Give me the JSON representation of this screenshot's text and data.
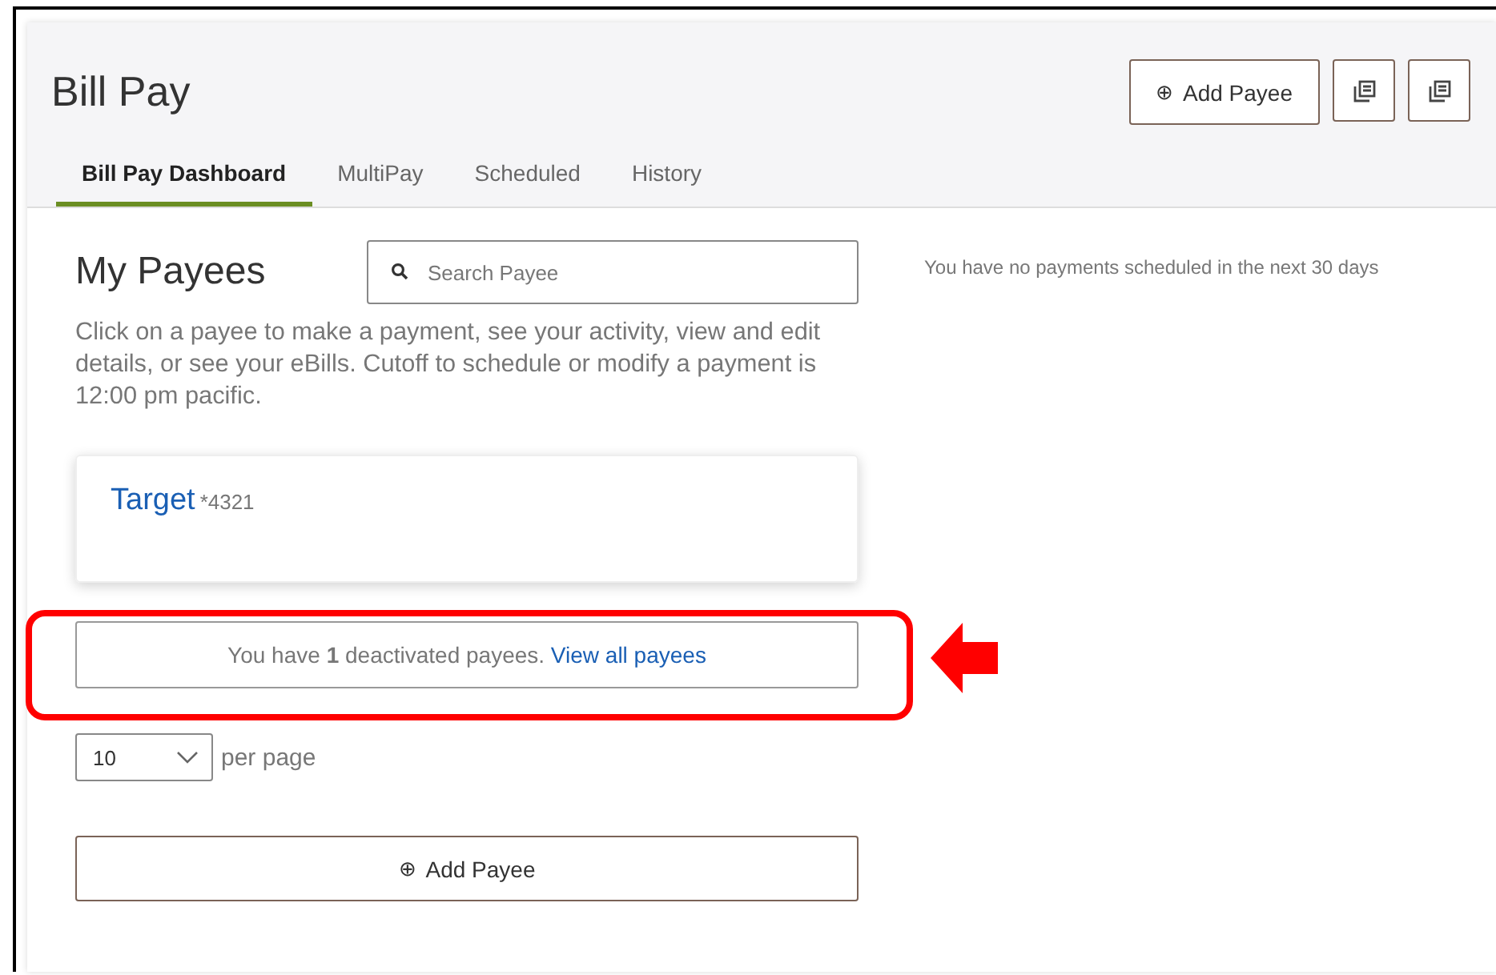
{
  "header": {
    "title": "Bill Pay",
    "add_payee_button": {
      "icon": "⊕",
      "label": "Add Payee"
    }
  },
  "tabs": [
    {
      "label": "Bill Pay Dashboard",
      "selected": true
    },
    {
      "label": "MultiPay",
      "selected": false
    },
    {
      "label": "Scheduled",
      "selected": false
    },
    {
      "label": "History",
      "selected": false
    }
  ],
  "payees_section": {
    "title": "My Payees",
    "search": {
      "placeholder": "Search Payee"
    },
    "description": "Click on a payee to make a payment, see your activity, view and edit details, or see your eBills. Cutoff to schedule or modify a payment is 12:00 pm pacific.",
    "payees": [
      {
        "name": "Target",
        "account": "*4321"
      }
    ],
    "deactivated_notice": {
      "text": "You have **1** deactivated payees.",
      "link": "View all payees",
      "highlighted": true
    },
    "per_page": {
      "value": "10",
      "label": "per page"
    },
    "add_payee_button": {
      "icon": "⊕",
      "label": "Add Payee"
    }
  },
  "scheduled_message": "You have no payments scheduled in the next 30 days"
}
